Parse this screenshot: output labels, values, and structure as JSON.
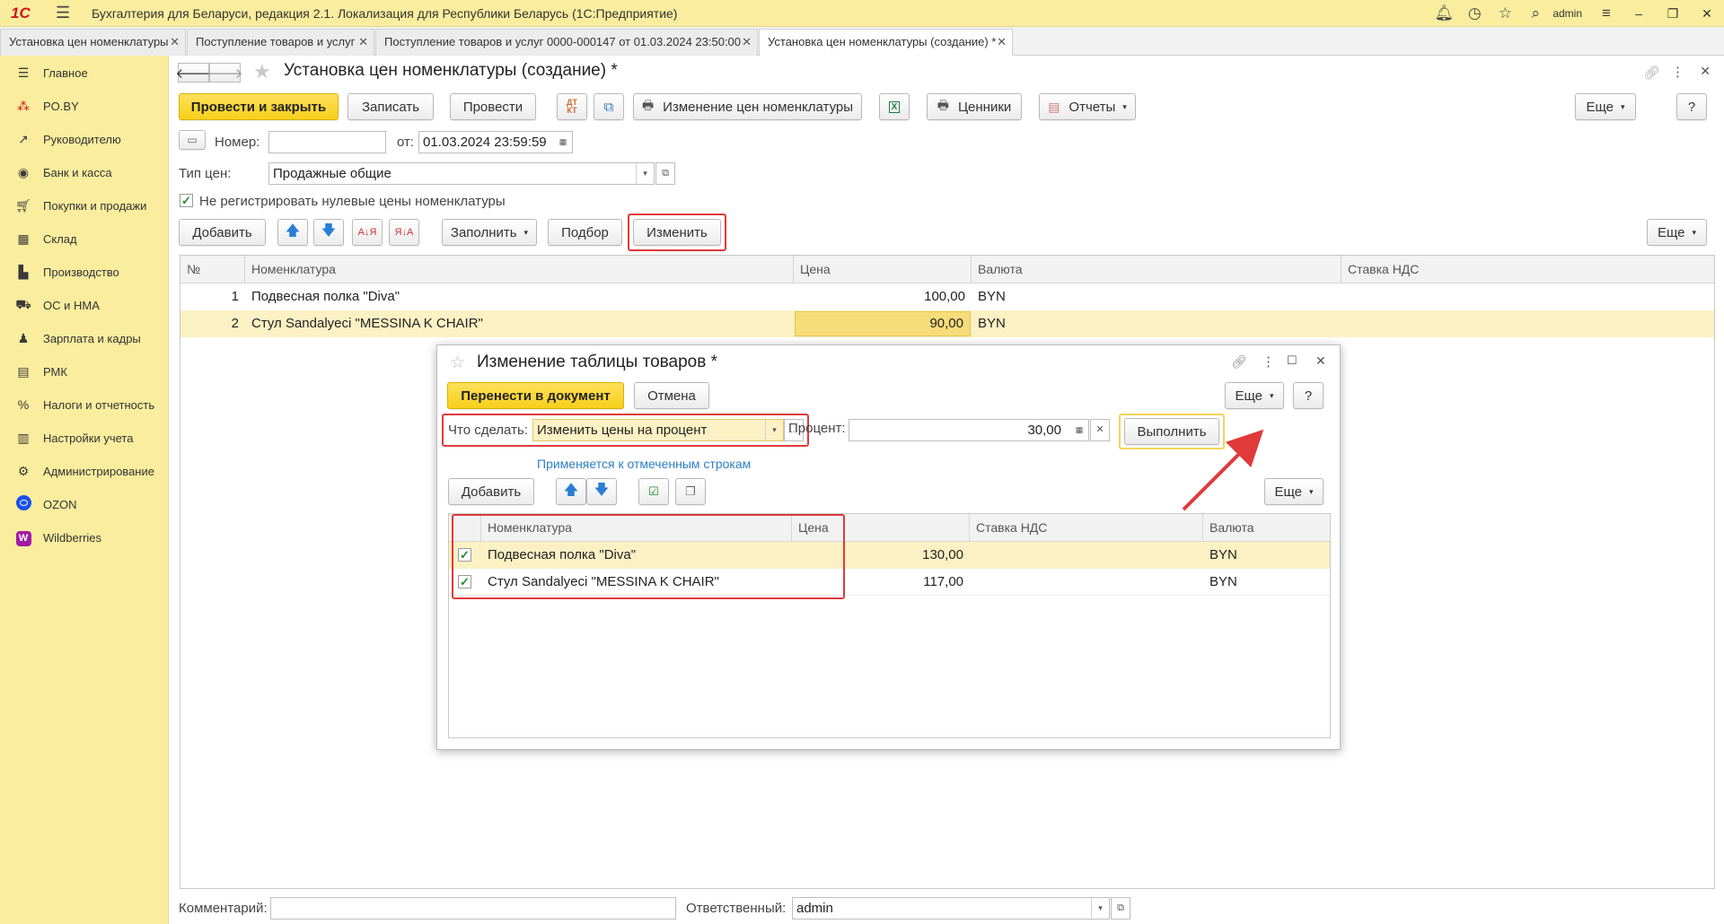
{
  "app": {
    "title": "Бухгалтерия для Беларуси, редакция 2.1. Локализация для Республики Беларусь   (1С:Предприятие)",
    "logo": "1С",
    "user": "admin"
  },
  "tabs": [
    {
      "label": "Установка цен номенклатуры"
    },
    {
      "label": "Поступление товаров и услуг"
    },
    {
      "label": "Поступление товаров и услуг 0000-000147 от 01.03.2024 23:50:00"
    },
    {
      "label": "Установка цен номенклатуры (создание) *"
    }
  ],
  "sidebar": {
    "items": [
      {
        "label": "Главное",
        "icon": "menu-lines-icon"
      },
      {
        "label": "PO.BY",
        "icon": "po-by-icon"
      },
      {
        "label": "Руководителю",
        "icon": "trend-icon"
      },
      {
        "label": "Банк и касса",
        "icon": "coin-icon"
      },
      {
        "label": "Покупки и продажи",
        "icon": "cart-icon"
      },
      {
        "label": "Склад",
        "icon": "warehouse-icon"
      },
      {
        "label": "Производство",
        "icon": "factory-icon"
      },
      {
        "label": "ОС и НМА",
        "icon": "truck-icon"
      },
      {
        "label": "Зарплата и кадры",
        "icon": "person-icon"
      },
      {
        "label": "РМК",
        "icon": "cash-register-icon"
      },
      {
        "label": "Налоги и отчетность",
        "icon": "tax-icon"
      },
      {
        "label": "Настройки учета",
        "icon": "settings-book-icon"
      },
      {
        "label": "Администрирование",
        "icon": "gear-icon"
      },
      {
        "label": "OZON",
        "icon": "ozon-icon"
      },
      {
        "label": "Wildberries",
        "icon": "wildberries-icon"
      }
    ]
  },
  "form": {
    "title": "Установка цен номенклатуры (создание) *",
    "toolbar": {
      "post_close": "Провести и закрыть",
      "save": "Записать",
      "post": "Провести",
      "change_prices": "Изменение цен номенклатуры",
      "price_tags": "Ценники",
      "reports": "Отчеты",
      "more": "Еще",
      "help": "?"
    },
    "number_label": "Номер:",
    "number_value": "",
    "date_label": "от:",
    "date_value": "01.03.2024 23:59:59",
    "price_type_label": "Тип цен:",
    "price_type_value": "Продажные общие",
    "no_zero_prices_label": "Не регистрировать нулевые цены номенклатуры",
    "no_zero_prices_checked": true,
    "table_toolbar": {
      "add": "Добавить",
      "fill": "Заполнить",
      "selection": "Подбор",
      "change": "Изменить",
      "more": "Еще"
    },
    "table": {
      "headers": {
        "num": "№",
        "item": "Номенклатура",
        "price": "Цена",
        "currency": "Валюта",
        "vat": "Ставка НДС"
      },
      "rows": [
        {
          "num": "1",
          "item": "Подвесная полка \"Diva\"",
          "price": "100,00",
          "currency": "BYN",
          "vat": ""
        },
        {
          "num": "2",
          "item": "Стул Sandalyeci \"MESSINA K CHAIR\"",
          "price": "90,00",
          "currency": "BYN",
          "vat": ""
        }
      ]
    },
    "comment_label": "Комментарий:",
    "comment_value": "",
    "responsible_label": "Ответственный:",
    "responsible_value": "admin"
  },
  "dialog": {
    "title": "Изменение таблицы товаров *",
    "transfer": "Перенести в документ",
    "cancel": "Отмена",
    "more": "Еще",
    "help": "?",
    "action_label": "Что сделать:",
    "action_value": "Изменить цены на процент",
    "ellipsis": "...",
    "percent_label": "Процент:",
    "percent_value": "30,00",
    "execute": "Выполнить",
    "applies_note": "Применяется к отмеченным строкам",
    "add": "Добавить",
    "more2": "Еще",
    "table": {
      "headers": {
        "item": "Номенклатура",
        "price": "Цена",
        "vat": "Ставка НДС",
        "currency": "Валюта"
      },
      "rows": [
        {
          "checked": true,
          "item": "Подвесная полка \"Diva\"",
          "price": "130,00",
          "vat": "",
          "currency": "BYN"
        },
        {
          "checked": true,
          "item": "Стул Sandalyeci \"MESSINA K CHAIR\"",
          "price": "117,00",
          "vat": "",
          "currency": "BYN"
        }
      ]
    }
  },
  "colors": {
    "accent_yellow": "#fbed9e",
    "primary_button": "#f7cf1a",
    "highlight_red": "#e03a3a",
    "link_blue": "#2d7fc4"
  }
}
